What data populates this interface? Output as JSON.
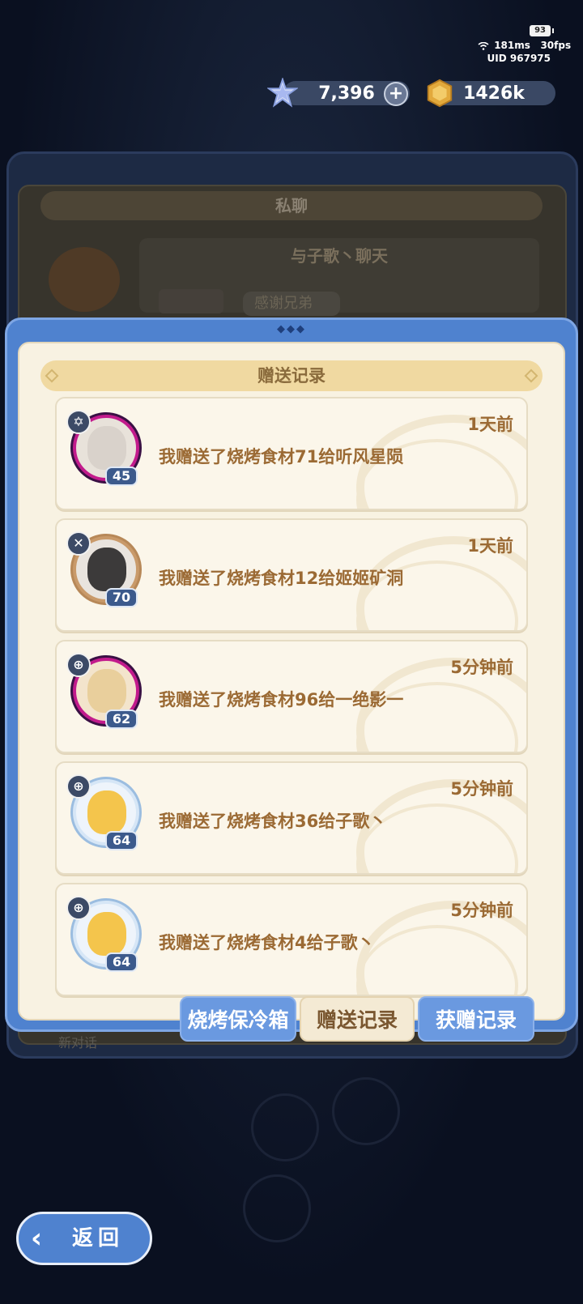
{
  "status": {
    "battery": "93",
    "ping": "181ms",
    "fps": "30fps",
    "uid": "UID 967975"
  },
  "currency": {
    "gems": "7,396",
    "coins": "1426k"
  },
  "background_panel": {
    "header": "私聊",
    "chat_title": "与子歌丶聊天",
    "bubble": "感谢兄弟",
    "new_dialog": "新对话"
  },
  "modal": {
    "title": "赠送记录",
    "records": [
      {
        "time": "1天前",
        "text": "我赠送了烧烤食材71给听风星陨",
        "level": "45",
        "class_symbol": "✡",
        "frame": "purple"
      },
      {
        "time": "1天前",
        "text": "我赠送了烧烤食材12给姬姬矿洞",
        "level": "70",
        "class_symbol": "✕",
        "frame": "bronze"
      },
      {
        "time": "5分钟前",
        "text": "我赠送了烧烤食材96给一绝影一",
        "level": "62",
        "class_symbol": "⊕",
        "frame": "purple"
      },
      {
        "time": "5分钟前",
        "text": "我赠送了烧烤食材36给子歌丶",
        "level": "64",
        "class_symbol": "⊕",
        "frame": "ice"
      },
      {
        "time": "5分钟前",
        "text": "我赠送了烧烤食材4给子歌丶",
        "level": "64",
        "class_symbol": "⊕",
        "frame": "ice"
      }
    ]
  },
  "tabs": [
    {
      "label": "烧烤保冷箱"
    },
    {
      "label": "赠送记录"
    },
    {
      "label": "获赠记录"
    }
  ],
  "back_button": {
    "label": "返回"
  },
  "colors": {
    "modal_blue": "#4f82cf",
    "cream": "#f8f2e2",
    "text_brown": "#9b6a34"
  }
}
